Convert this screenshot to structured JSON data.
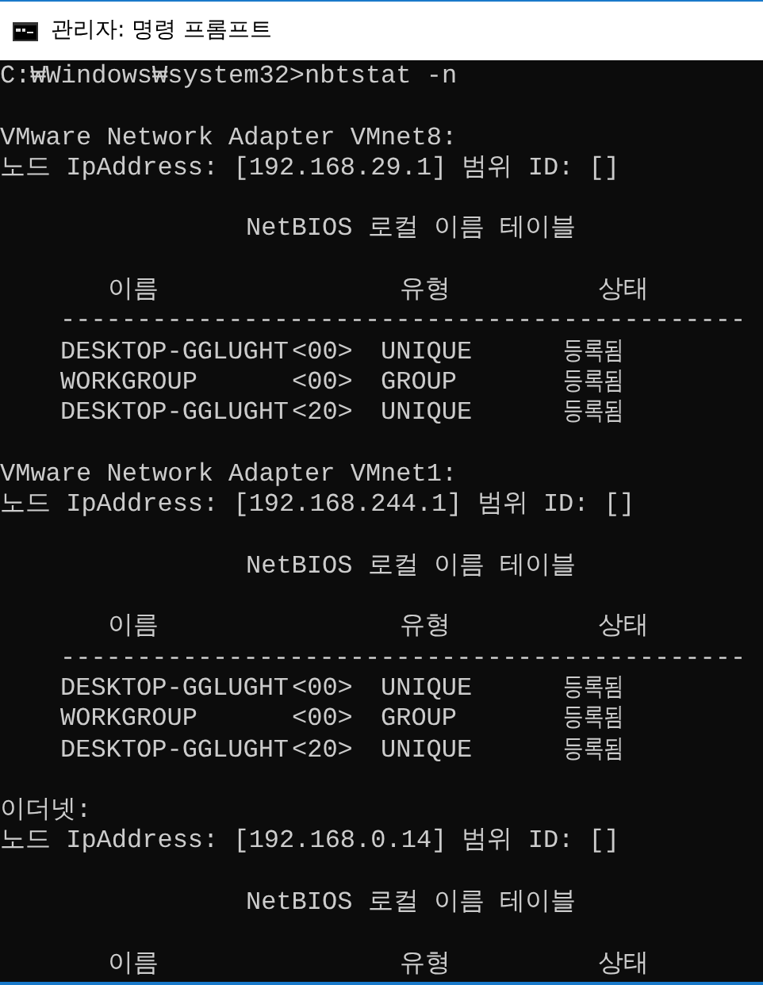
{
  "window": {
    "title": "관리자: 명령 프롬프트"
  },
  "command": "C:₩Windows₩system32>nbtstat -n",
  "adapters": [
    {
      "name": "VMware Network Adapter VMnet8:",
      "node_line": "노드 IpAddress: [192.168.29.1] 범위 ID: []",
      "table_title": "NetBIOS 로컬 이름 테이블",
      "columns": [
        "이름",
        "유형",
        "상태"
      ],
      "separator": "---------------------------------------------",
      "rows": [
        {
          "name": "DESKTOP-GGLUGHT",
          "suffix": "<00>",
          "type": "UNIQUE",
          "status": "등록됨"
        },
        {
          "name": "WORKGROUP",
          "suffix": "<00>",
          "type": "GROUP",
          "status": "등록됨"
        },
        {
          "name": "DESKTOP-GGLUGHT",
          "suffix": "<20>",
          "type": "UNIQUE",
          "status": "등록됨"
        }
      ]
    },
    {
      "name": "VMware Network Adapter VMnet1:",
      "node_line": "노드 IpAddress: [192.168.244.1] 범위 ID: []",
      "table_title": "NetBIOS 로컬 이름 테이블",
      "columns": [
        "이름",
        "유형",
        "상태"
      ],
      "separator": "---------------------------------------------",
      "rows": [
        {
          "name": "DESKTOP-GGLUGHT",
          "suffix": "<00>",
          "type": "UNIQUE",
          "status": "등록됨"
        },
        {
          "name": "WORKGROUP",
          "suffix": "<00>",
          "type": "GROUP",
          "status": "등록됨"
        },
        {
          "name": "DESKTOP-GGLUGHT",
          "suffix": "<20>",
          "type": "UNIQUE",
          "status": "등록됨"
        }
      ]
    },
    {
      "name": "이더넷:",
      "node_line": "노드 IpAddress: [192.168.0.14] 범위 ID: []",
      "table_title": "NetBIOS 로컬 이름 테이블",
      "columns": [
        "이름",
        "유형",
        "상태"
      ]
    }
  ]
}
